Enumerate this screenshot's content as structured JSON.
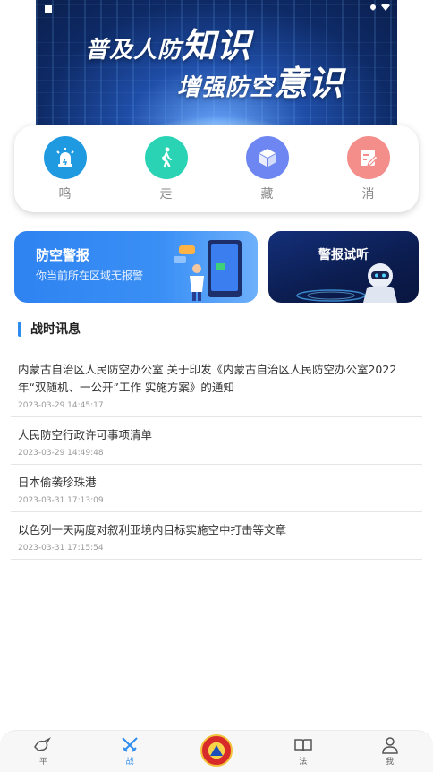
{
  "banner": {
    "line1_prefix": "普及人防",
    "line1_big": "知识",
    "line2_prefix": "增强防空",
    "line2_big": "意识"
  },
  "actions": [
    {
      "label": "鸣",
      "icon": "siren-icon",
      "color": "#1f9ae0"
    },
    {
      "label": "走",
      "icon": "walking-person-icon",
      "color": "#2bd3b5"
    },
    {
      "label": "藏",
      "icon": "shelter-box-icon",
      "color": "#6d86f2"
    },
    {
      "label": "消",
      "icon": "edit-document-icon",
      "color": "#f48e8a"
    }
  ],
  "alert_card": {
    "title": "防空警报",
    "subtitle": "你当前所在区域无报警"
  },
  "listen_card": {
    "title": "警报试听"
  },
  "section": {
    "title": "战时讯息"
  },
  "news": [
    {
      "headline": "内蒙古自治区人民防空办公室  关于印发《内蒙古自治区人民防空办公室2022年“双随机、一公开”工作  实施方案》的通知",
      "time": "2023-03-29 14:45:17"
    },
    {
      "headline": "人民防空行政许可事项清单",
      "time": "2023-03-29 14:49:48"
    },
    {
      "headline": "日本偷袭珍珠港",
      "time": "2023-03-31 17:13:09"
    },
    {
      "headline": "以色列一天两度对叙利亚境内目标实施空中打击等文章",
      "time": "2023-03-31 17:15:54"
    }
  ],
  "nav": [
    {
      "label": "平",
      "icon": "dove-icon",
      "active": false
    },
    {
      "label": "战",
      "icon": "crossed-swords-icon",
      "active": true
    },
    {
      "label": "法",
      "icon": "open-book-icon",
      "active": false
    },
    {
      "label": "我",
      "icon": "user-icon",
      "active": false
    }
  ],
  "colors": {
    "accent": "#2d8cf0",
    "alert_card": "#2f83f1",
    "listen_card": "#0b1c4e"
  }
}
